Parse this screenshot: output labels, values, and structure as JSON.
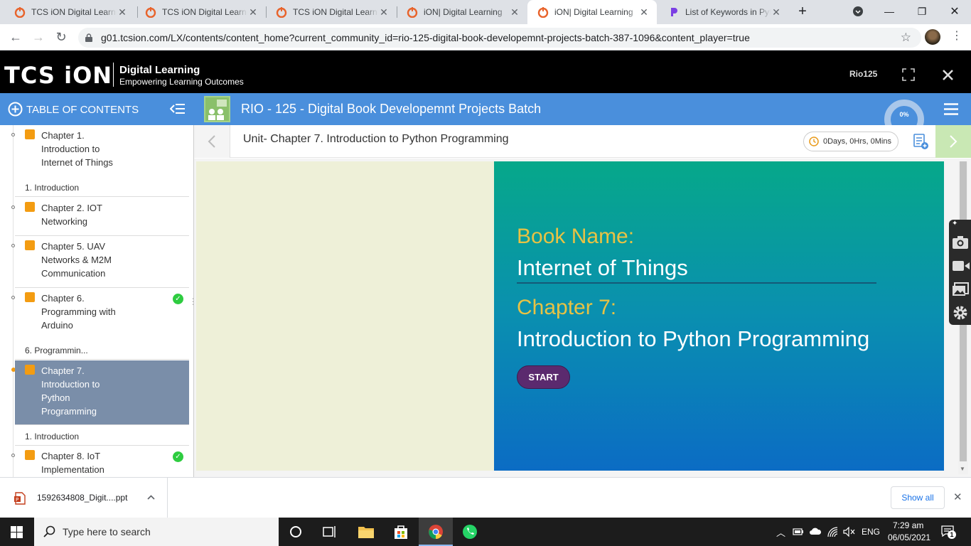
{
  "browser": {
    "tabs": [
      {
        "title": "TCS iON Digital Learning",
        "favicon": "tcs-ion-icon",
        "active": false
      },
      {
        "title": "TCS iON Digital Learning",
        "favicon": "tcs-ion-icon",
        "active": false
      },
      {
        "title": "TCS iON Digital Learning",
        "favicon": "tcs-ion-icon",
        "active": false
      },
      {
        "title": "iON| Digital Learning",
        "favicon": "tcs-ion-icon",
        "active": false
      },
      {
        "title": "iON| Digital Learning",
        "favicon": "tcs-ion-icon",
        "active": true
      },
      {
        "title": "List of Keywords in Python",
        "favicon": "p-icon",
        "active": false
      }
    ],
    "new_tab_label": "+",
    "url": "g01.tcsion.com/LX/contents/content_home?current_community_id=rio-125-digital-book-developemnt-projects-batch-387-1096&content_player=true"
  },
  "app": {
    "logo": "TCS iON",
    "product": "Digital Learning",
    "tagline": "Empowering Learning Outcomes",
    "user": "Rio125"
  },
  "toc": {
    "title": "TABLE OF CONTENTS",
    "items": [
      {
        "type": "chapter",
        "lines": [
          "Chapter 1.",
          "Introduction to",
          "Internet of Things"
        ],
        "done": false,
        "selected": false
      },
      {
        "type": "sub",
        "label": "1. Introduction"
      },
      {
        "type": "chapter",
        "lines": [
          "Chapter 2. IOT",
          "Networking"
        ],
        "done": false,
        "selected": false
      },
      {
        "type": "chapter",
        "lines": [
          "Chapter 5. UAV",
          "Networks & M2M",
          "Communication"
        ],
        "done": false,
        "selected": false
      },
      {
        "type": "chapter",
        "lines": [
          "Chapter 6.",
          "Programming with",
          "Arduino"
        ],
        "done": true,
        "selected": false
      },
      {
        "type": "sub",
        "label": "6. Programmin..."
      },
      {
        "type": "chapter",
        "lines": [
          "Chapter 7.",
          "Introduction to",
          "Python",
          "Programming"
        ],
        "done": false,
        "selected": true
      },
      {
        "type": "sub",
        "label": "1. Introduction"
      },
      {
        "type": "chapter",
        "lines": [
          "Chapter 8. IoT",
          "Implementation"
        ],
        "done": true,
        "selected": false
      }
    ]
  },
  "course": {
    "title": "RIO - 125 - Digital Book Developemnt Projects Batch",
    "progress": "0%"
  },
  "unit": {
    "title": "Unit- Chapter 7. Introduction to Python Programming",
    "timer": "0Days, 0Hrs, 0Mins"
  },
  "slide": {
    "book_label": "Book Name:",
    "book_name": "Internet of Things",
    "chapter_label": "Chapter 7:",
    "chapter_name": "Introduction to Python Programming",
    "start_label": "START"
  },
  "download": {
    "filename": "1592634808_Digit....ppt",
    "show_all": "Show all"
  },
  "taskbar": {
    "search_placeholder": "Type here to search",
    "lang": "ENG",
    "time": "7:29 am",
    "date": "06/05/2021",
    "notifications": "1"
  },
  "colors": {
    "blue_bar": "#4a8fdc",
    "start_button": "#5b2a6e",
    "slide_label": "#e8c244"
  }
}
